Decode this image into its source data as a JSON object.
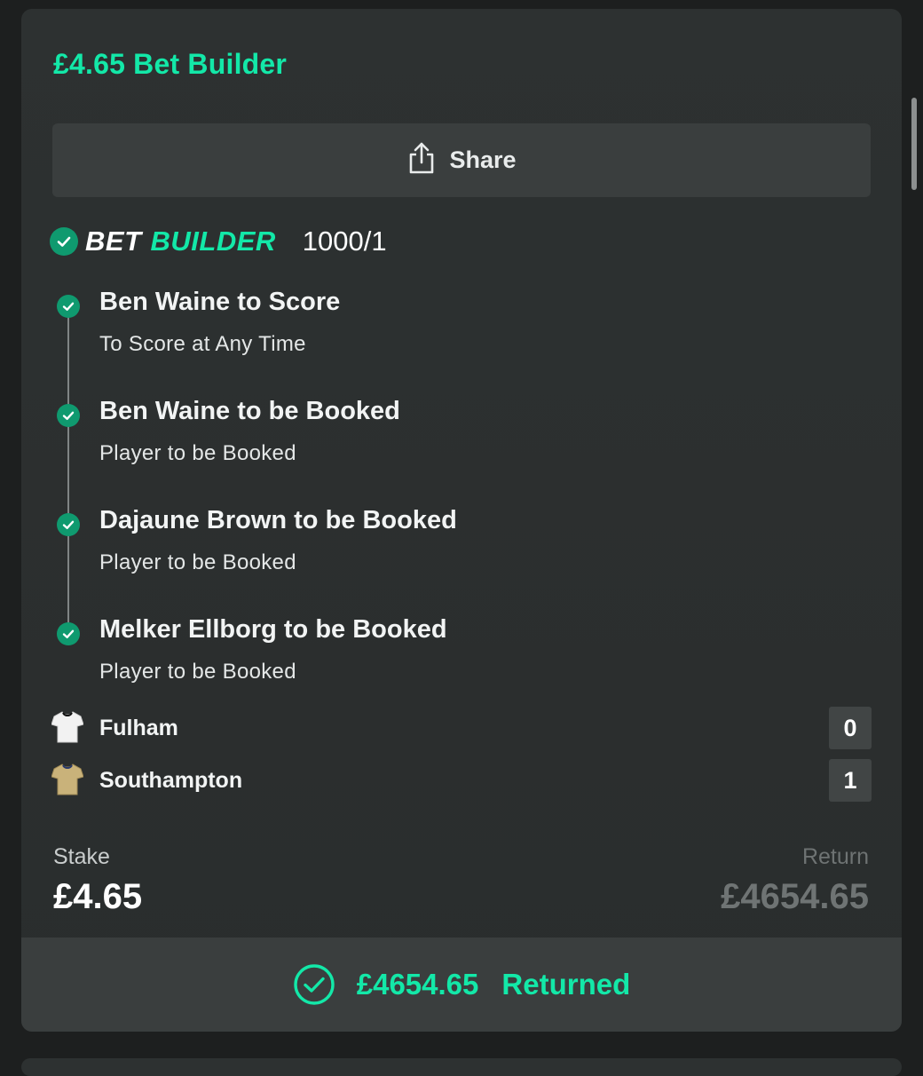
{
  "bet": {
    "title": "£4.65 Bet Builder",
    "share_label": "Share",
    "builder_word1": "BET",
    "builder_word2": "BUILDER",
    "odds": "1000/1",
    "legs": [
      {
        "name": "Ben Waine to Score",
        "market": "To Score at Any Time",
        "status": "won"
      },
      {
        "name": "Ben Waine to be Booked",
        "market": "Player to be Booked",
        "status": "won"
      },
      {
        "name": "Dajaune Brown to be Booked",
        "market": "Player to be Booked",
        "status": "won"
      },
      {
        "name": "Melker Ellborg to be Booked",
        "market": "Player to be Booked",
        "status": "won"
      }
    ],
    "teams": [
      {
        "name": "Fulham",
        "score": "0",
        "shirt_color": "#f2f2f2"
      },
      {
        "name": "Southampton",
        "score": "1",
        "shirt_color": "#c9b27a"
      }
    ],
    "stake_label": "Stake",
    "stake_value": "£4.65",
    "return_label": "Return",
    "return_value": "£4654.65",
    "returned_amount": "£4654.65",
    "returned_text": "Returned"
  },
  "colors": {
    "accent": "#13e8a8",
    "success": "#0f9a6f",
    "card_bg": "#2d3131",
    "button_bg": "#3a3e3e"
  },
  "icons": {
    "share": "share-icon",
    "check": "check-icon",
    "returned": "check-circle-icon",
    "shirt": "shirt-icon"
  }
}
